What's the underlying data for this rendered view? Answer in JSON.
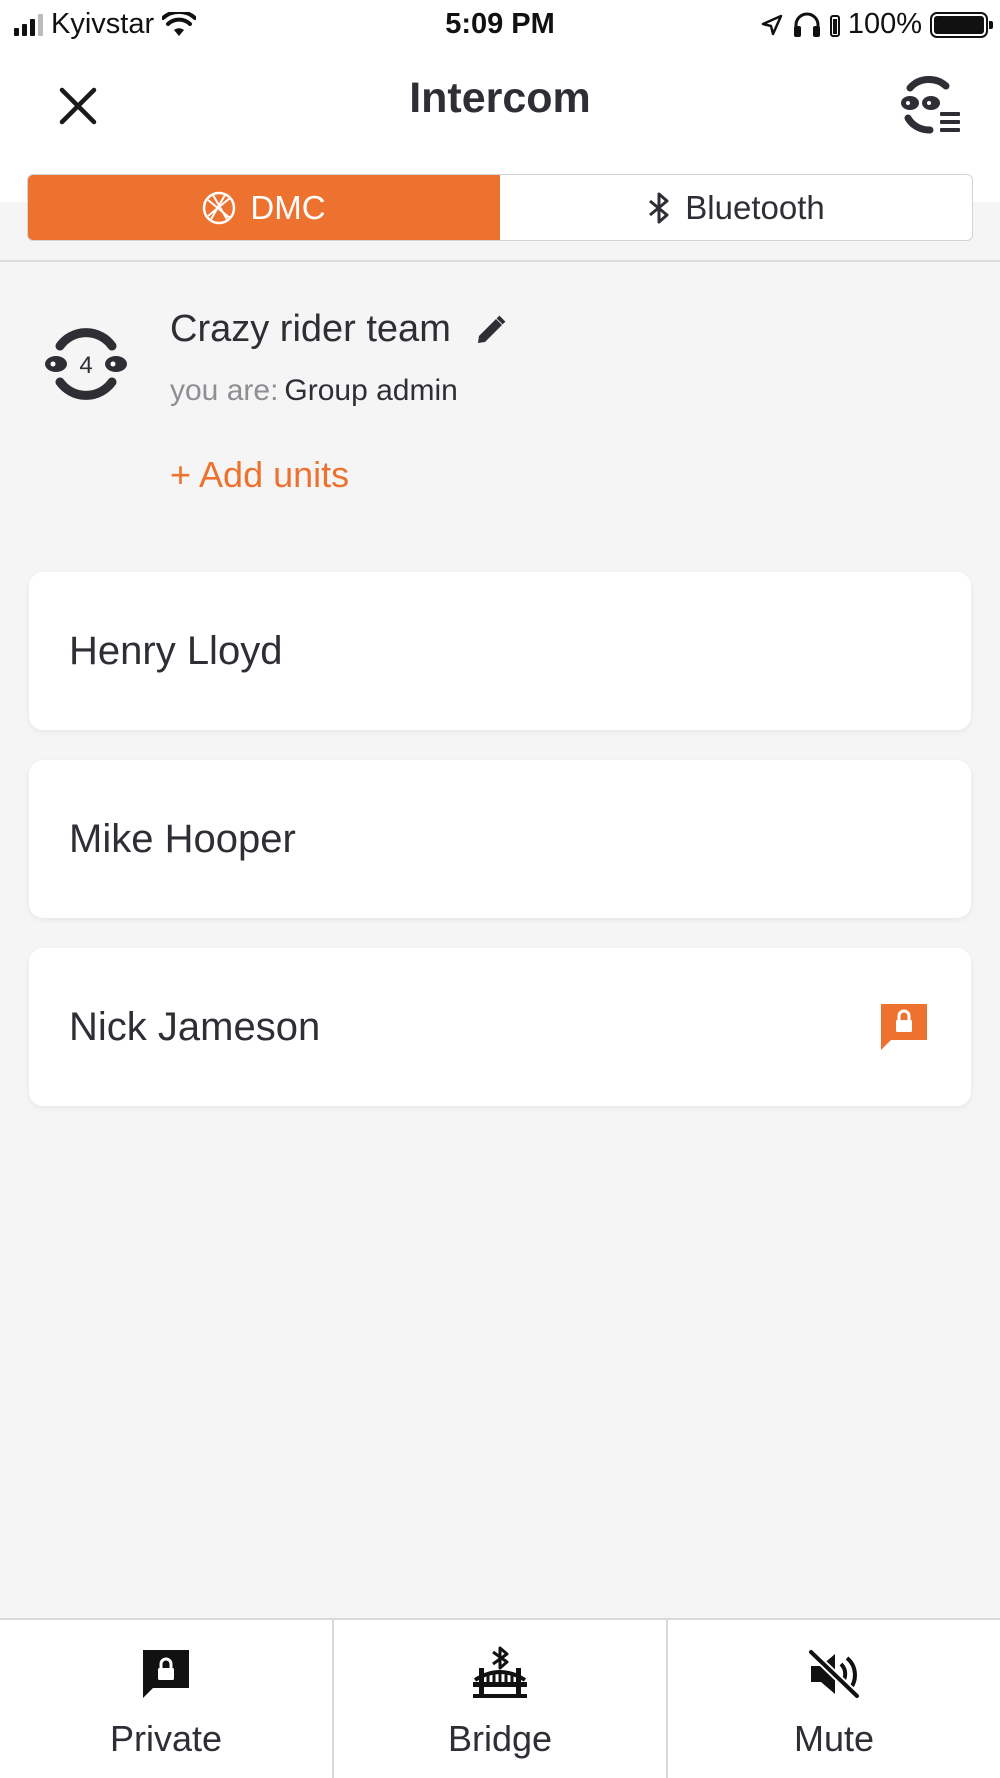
{
  "status_bar": {
    "carrier": "Kyivstar",
    "time": "5:09 PM",
    "battery": "100%"
  },
  "header": {
    "title": "Intercom",
    "tabs": [
      {
        "label": "DMC",
        "icon": "dmc-icon",
        "active": true
      },
      {
        "label": "Bluetooth",
        "icon": "bluetooth-icon",
        "active": false
      }
    ]
  },
  "group": {
    "name": "Crazy rider team",
    "member_count": "4",
    "role_label": "you are:",
    "role_value": "Group admin",
    "add_units_label": "+ Add units"
  },
  "members": [
    {
      "name": "Henry Lloyd",
      "private": false
    },
    {
      "name": "Mike Hooper",
      "private": false
    },
    {
      "name": "Nick Jameson",
      "private": true
    }
  ],
  "bottom_bar": {
    "private_label": "Private",
    "bridge_label": "Bridge",
    "mute_label": "Mute"
  },
  "colors": {
    "accent": "#ed7230",
    "text": "#2e2e34",
    "background": "#f5f5f5"
  }
}
